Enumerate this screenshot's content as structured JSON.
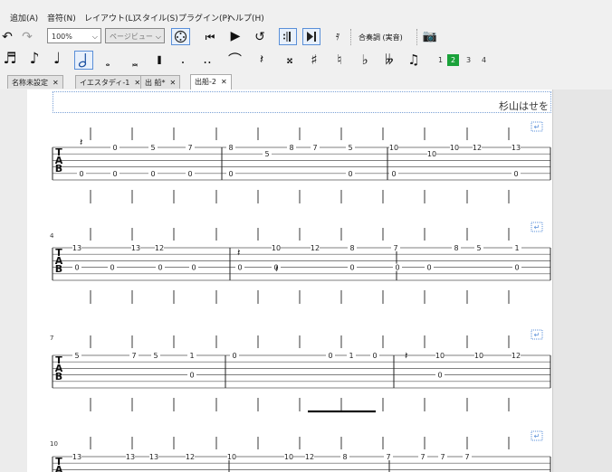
{
  "menu": [
    "追加(A)",
    "音符(N)",
    "レイアウト(L)",
    "スタイル(S)",
    "プラグイン(P)",
    "ヘルプ(H)"
  ],
  "toolbar": {
    "zoom": "100%",
    "view_mode": "ページビュー",
    "concert_pitch": "合奏調 (実音)"
  },
  "voices": [
    "1",
    "2",
    "3",
    "4"
  ],
  "active_voice": "2",
  "tabs": [
    "名称未設定",
    "イエスタディ-1",
    "出 船*",
    "出船-2"
  ],
  "active_tab": "出船-2",
  "score": {
    "composer": "杉山はせを",
    "systems": [
      {
        "number": "",
        "rows": [
          [
            "",
            "0",
            "5",
            "7",
            "8",
            "",
            "8",
            "7",
            "5",
            "10",
            "",
            "10",
            "12",
            "13"
          ],
          [
            "",
            "",
            "",
            "",
            "",
            "5",
            "",
            "",
            "",
            "",
            "10",
            "",
            "",
            ""
          ],
          [
            "0",
            "0",
            "0",
            "0",
            "0",
            "",
            "",
            "",
            "0",
            "0",
            "",
            "",
            "",
            "0"
          ]
        ]
      },
      {
        "number": "4",
        "top": [
          "13",
          "13",
          "12",
          "10",
          "12",
          "8",
          "7",
          "8",
          "5",
          "1"
        ],
        "mid": [
          "0",
          "0",
          "0",
          "0",
          "0",
          "0",
          "0",
          "0",
          "0",
          "0"
        ]
      },
      {
        "number": "7",
        "top": [
          "5",
          "7",
          "5",
          "1",
          "0",
          "0",
          "1",
          "0",
          "10",
          "10",
          "12"
        ],
        "mid": [
          "0",
          "0"
        ]
      },
      {
        "number": "10",
        "top": [
          "13",
          "13",
          "13",
          "12",
          "10",
          "10",
          "12",
          "8",
          "7",
          "7",
          "7",
          "7"
        ]
      }
    ]
  },
  "colors": {
    "active_voice_bg": "#1aa23a",
    "selection_blue": "#5a8fd8",
    "staff_line": "#555555"
  }
}
